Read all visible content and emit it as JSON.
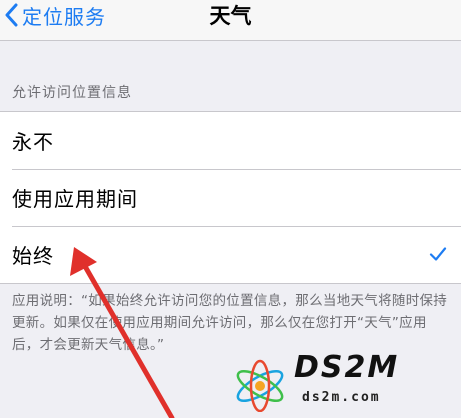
{
  "navbar": {
    "back_label": "定位服务",
    "title": "天气"
  },
  "section": {
    "header": "允许访问位置信息",
    "options": [
      {
        "label": "永不",
        "selected": false
      },
      {
        "label": "使用应用期间",
        "selected": false
      },
      {
        "label": "始终",
        "selected": true
      }
    ]
  },
  "footer": {
    "note": "应用说明：“如果始终允许访问您的位置信息，那么当地天气将随时保持更新。如果仅在使用应用期间允许访问，那么仅在您打开“天气”应用后，才会更新天气信息。”"
  },
  "watermark": {
    "brand": "DS2M",
    "domain": "ds2m.com"
  },
  "colors": {
    "accent": "#1d7cf2",
    "annotation_arrow": "#e0302b"
  }
}
